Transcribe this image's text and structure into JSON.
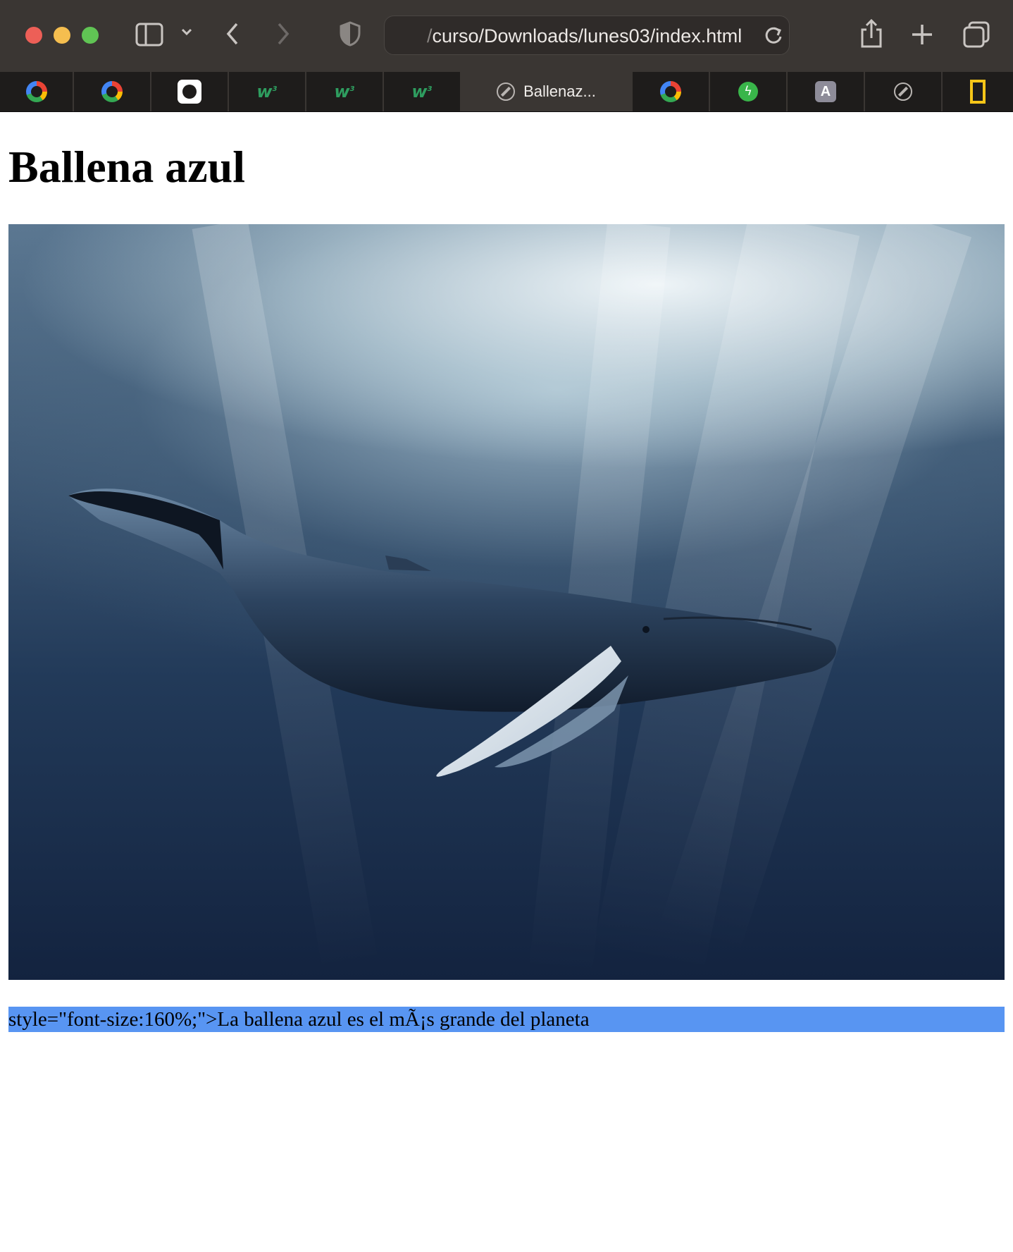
{
  "browser": {
    "address": {
      "dim_prefix": "/",
      "url_text": "curso/Downloads/lunes03/index.html"
    },
    "tabs": [
      {
        "icon": "google-icon"
      },
      {
        "icon": "google-icon"
      },
      {
        "icon": "github-icon"
      },
      {
        "icon": "w3schools-icon"
      },
      {
        "icon": "w3schools-icon"
      },
      {
        "icon": "w3schools-icon"
      },
      {
        "icon": "compass-icon",
        "label": "Ballenaz...",
        "active": true
      },
      {
        "icon": "google-icon"
      },
      {
        "icon": "bolt-icon"
      },
      {
        "icon": "a-icon",
        "glyph": "A"
      },
      {
        "icon": "compass-icon"
      },
      {
        "icon": "natgeo-icon"
      }
    ]
  },
  "page": {
    "heading": "Ballena azul",
    "image_subject": "humpback whale swimming underwater below sunlit surface",
    "caption": "style=\"font-size:160%;\">La ballena azul es el mÃ¡s grande del planeta"
  }
}
